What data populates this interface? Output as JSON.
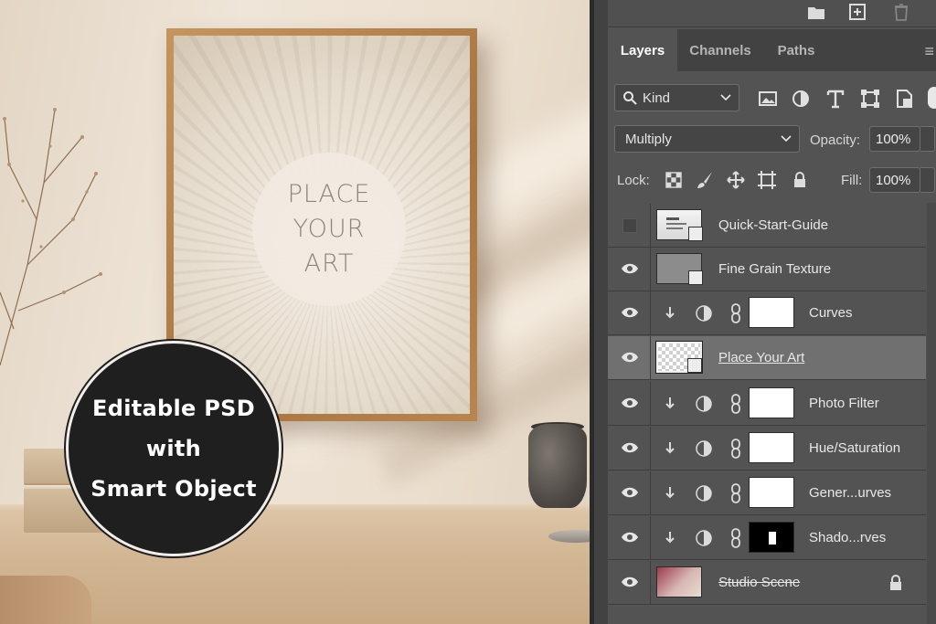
{
  "mockup": {
    "art_placeholder": [
      "PLACE",
      "YOUR",
      "ART"
    ],
    "badge": [
      "Editable PSD",
      "with",
      "Smart Object"
    ]
  },
  "panel": {
    "top_icons": [
      "folder-icon",
      "new-layer-icon",
      "trash-icon"
    ],
    "tabs": [
      {
        "label": "Layers",
        "active": true
      },
      {
        "label": "Channels",
        "active": false
      },
      {
        "label": "Paths",
        "active": false
      }
    ],
    "filter": {
      "kind_label": "Kind",
      "icons": [
        "image-filter-icon",
        "adjustment-filter-icon",
        "type-filter-icon",
        "shape-filter-icon",
        "smart-object-filter-icon"
      ]
    },
    "blend": {
      "mode": "Multiply",
      "opacity_label": "Opacity:",
      "opacity_value": "100%"
    },
    "lock": {
      "label": "Lock:",
      "icons": [
        "lock-transparency-icon",
        "lock-paint-icon",
        "lock-position-icon",
        "lock-artboard-icon",
        "lock-all-icon"
      ],
      "fill_label": "Fill:",
      "fill_value": "100%"
    },
    "layers": [
      {
        "name": "Quick-Start-Guide",
        "type": "smart",
        "visible": false
      },
      {
        "name": "Fine Grain Texture",
        "type": "smart",
        "visible": true
      },
      {
        "name": "Curves",
        "type": "adjustment",
        "visible": true
      },
      {
        "name": "Place Your Art",
        "type": "smart",
        "visible": true,
        "selected": true
      },
      {
        "name": "Photo Filter",
        "type": "adjustment",
        "visible": true
      },
      {
        "name": "Hue/Saturation",
        "type": "adjustment",
        "visible": true
      },
      {
        "name": "Gener...urves",
        "type": "adjustment",
        "visible": true
      },
      {
        "name": "Shado...rves",
        "type": "adjustment",
        "visible": true
      },
      {
        "name": "Studio Scene",
        "type": "background",
        "visible": true,
        "locked": true
      }
    ]
  },
  "colors": {
    "panel_bg": "#535353",
    "tabbar_bg": "#424242",
    "selected_layer": "#707070",
    "badge_bg": "#1f1f1f"
  }
}
